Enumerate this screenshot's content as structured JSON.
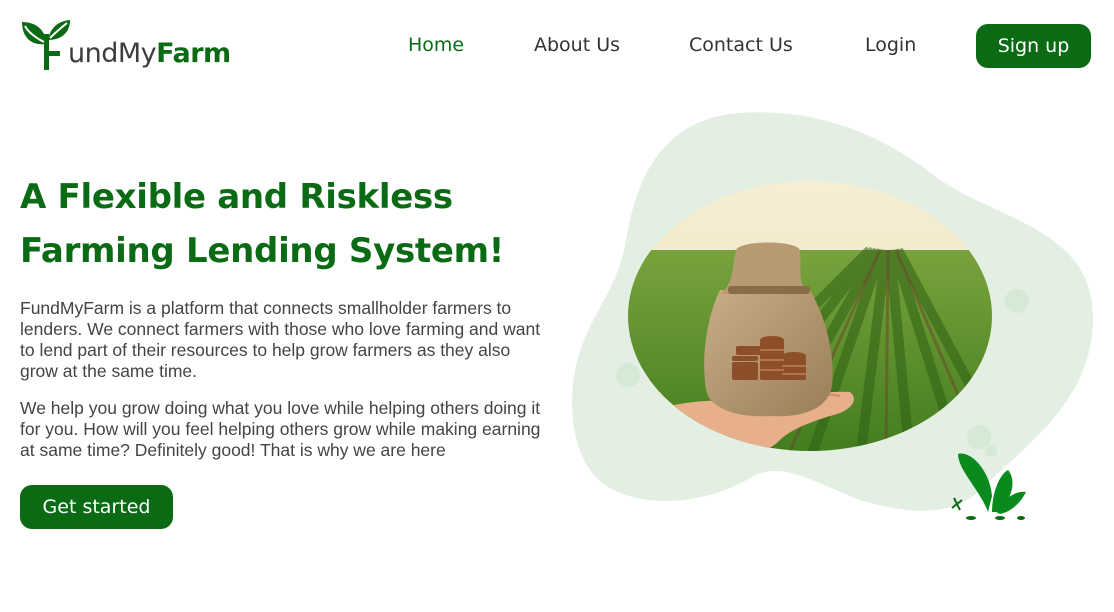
{
  "header": {
    "logo": {
      "prefix": "undMy",
      "bold": "Farm",
      "brand_name": "FundMyFarm"
    },
    "nav": [
      {
        "label": "Home",
        "active": true
      },
      {
        "label": "About Us",
        "active": false
      },
      {
        "label": "Contact Us",
        "active": false
      },
      {
        "label": "Login",
        "active": false
      }
    ],
    "signup_label": "Sign up"
  },
  "hero": {
    "title_line1": "A Flexible and Riskless",
    "title_line2": "Farming Lending System!",
    "paragraph1": "FundMyFarm is a platform that connects smallholder farmers to lenders. We connect farmers with those who love farming and want to lend part of their resources to help grow farmers as they also grow at the same time.",
    "paragraph2": "We help you grow doing what you love while helping others doing it for you. How will you feel helping others grow while making earning at same time? Definitely good! That is why we are here",
    "cta_label": "Get started",
    "image_subject": "hand-holding-money-sack-in-crop-field"
  },
  "colors": {
    "brand_green": "#0a6b14",
    "blob_green": "#e3efe3",
    "text_gray": "#444444"
  },
  "icons": {
    "logo": "sprout-icon",
    "illustration": "plant-sprout-icon"
  }
}
